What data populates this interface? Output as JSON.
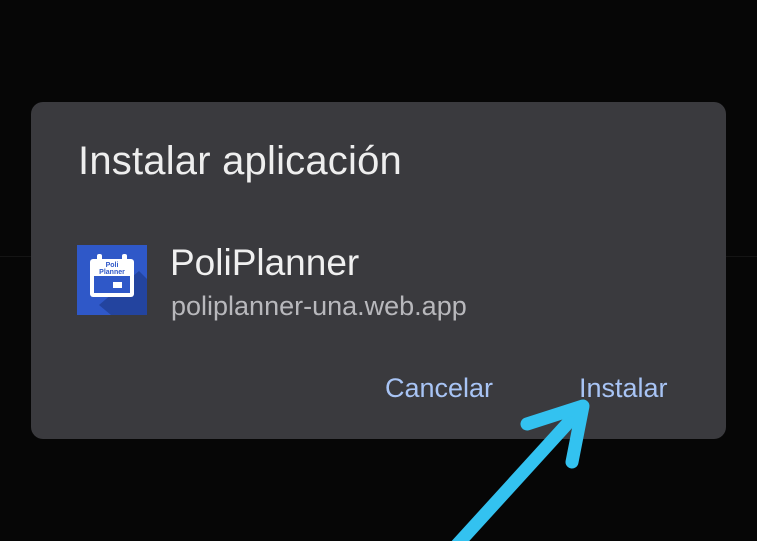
{
  "dialog": {
    "title": "Instalar aplicación",
    "app_name": "PoliPlanner",
    "app_url": "poliplanner-una.web.app",
    "icon_text_line1": "Poli",
    "icon_text_line2": "Planner",
    "cancel_label": "Cancelar",
    "install_label": "Instalar"
  },
  "colors": {
    "dialog_bg": "#3a3a3e",
    "button_text": "#a8c4f5",
    "arrow": "#33c2f0",
    "icon_bg": "#2f58c8"
  }
}
